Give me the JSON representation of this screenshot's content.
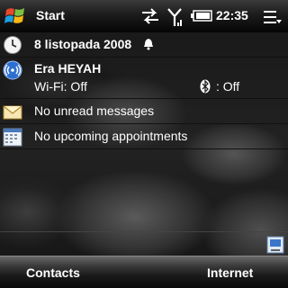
{
  "titlebar": {
    "title": "Start",
    "time": "22:35",
    "icons": [
      "windows-logo-icon",
      "sync-arrows-icon",
      "signal-strength-icon",
      "battery-icon",
      "menu-icon"
    ]
  },
  "today": {
    "date": "8 listopada 2008",
    "carrier": "Era HEYAH",
    "wifi": "Wi-Fi: Off",
    "bluetooth": ": Off",
    "messages": "No unread messages",
    "appointments": "No upcoming appointments"
  },
  "softkeys": {
    "left": "Contacts",
    "right": "Internet"
  }
}
